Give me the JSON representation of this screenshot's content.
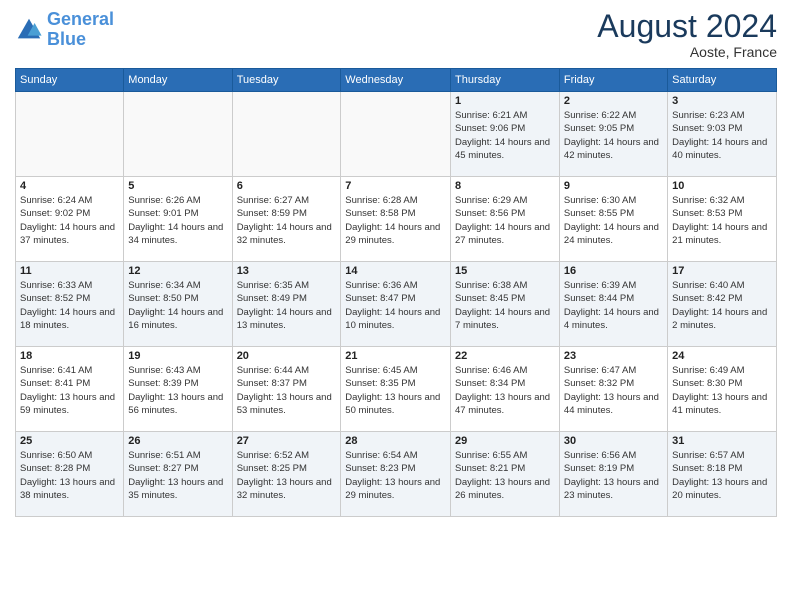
{
  "logo": {
    "line1": "General",
    "line2": "Blue"
  },
  "title": "August 2024",
  "location": "Aoste, France",
  "days_header": [
    "Sunday",
    "Monday",
    "Tuesday",
    "Wednesday",
    "Thursday",
    "Friday",
    "Saturday"
  ],
  "weeks": [
    [
      {
        "num": "",
        "info": ""
      },
      {
        "num": "",
        "info": ""
      },
      {
        "num": "",
        "info": ""
      },
      {
        "num": "",
        "info": ""
      },
      {
        "num": "1",
        "info": "Sunrise: 6:21 AM\nSunset: 9:06 PM\nDaylight: 14 hours and 45 minutes."
      },
      {
        "num": "2",
        "info": "Sunrise: 6:22 AM\nSunset: 9:05 PM\nDaylight: 14 hours and 42 minutes."
      },
      {
        "num": "3",
        "info": "Sunrise: 6:23 AM\nSunset: 9:03 PM\nDaylight: 14 hours and 40 minutes."
      }
    ],
    [
      {
        "num": "4",
        "info": "Sunrise: 6:24 AM\nSunset: 9:02 PM\nDaylight: 14 hours and 37 minutes."
      },
      {
        "num": "5",
        "info": "Sunrise: 6:26 AM\nSunset: 9:01 PM\nDaylight: 14 hours and 34 minutes."
      },
      {
        "num": "6",
        "info": "Sunrise: 6:27 AM\nSunset: 8:59 PM\nDaylight: 14 hours and 32 minutes."
      },
      {
        "num": "7",
        "info": "Sunrise: 6:28 AM\nSunset: 8:58 PM\nDaylight: 14 hours and 29 minutes."
      },
      {
        "num": "8",
        "info": "Sunrise: 6:29 AM\nSunset: 8:56 PM\nDaylight: 14 hours and 27 minutes."
      },
      {
        "num": "9",
        "info": "Sunrise: 6:30 AM\nSunset: 8:55 PM\nDaylight: 14 hours and 24 minutes."
      },
      {
        "num": "10",
        "info": "Sunrise: 6:32 AM\nSunset: 8:53 PM\nDaylight: 14 hours and 21 minutes."
      }
    ],
    [
      {
        "num": "11",
        "info": "Sunrise: 6:33 AM\nSunset: 8:52 PM\nDaylight: 14 hours and 18 minutes."
      },
      {
        "num": "12",
        "info": "Sunrise: 6:34 AM\nSunset: 8:50 PM\nDaylight: 14 hours and 16 minutes."
      },
      {
        "num": "13",
        "info": "Sunrise: 6:35 AM\nSunset: 8:49 PM\nDaylight: 14 hours and 13 minutes."
      },
      {
        "num": "14",
        "info": "Sunrise: 6:36 AM\nSunset: 8:47 PM\nDaylight: 14 hours and 10 minutes."
      },
      {
        "num": "15",
        "info": "Sunrise: 6:38 AM\nSunset: 8:45 PM\nDaylight: 14 hours and 7 minutes."
      },
      {
        "num": "16",
        "info": "Sunrise: 6:39 AM\nSunset: 8:44 PM\nDaylight: 14 hours and 4 minutes."
      },
      {
        "num": "17",
        "info": "Sunrise: 6:40 AM\nSunset: 8:42 PM\nDaylight: 14 hours and 2 minutes."
      }
    ],
    [
      {
        "num": "18",
        "info": "Sunrise: 6:41 AM\nSunset: 8:41 PM\nDaylight: 13 hours and 59 minutes."
      },
      {
        "num": "19",
        "info": "Sunrise: 6:43 AM\nSunset: 8:39 PM\nDaylight: 13 hours and 56 minutes."
      },
      {
        "num": "20",
        "info": "Sunrise: 6:44 AM\nSunset: 8:37 PM\nDaylight: 13 hours and 53 minutes."
      },
      {
        "num": "21",
        "info": "Sunrise: 6:45 AM\nSunset: 8:35 PM\nDaylight: 13 hours and 50 minutes."
      },
      {
        "num": "22",
        "info": "Sunrise: 6:46 AM\nSunset: 8:34 PM\nDaylight: 13 hours and 47 minutes."
      },
      {
        "num": "23",
        "info": "Sunrise: 6:47 AM\nSunset: 8:32 PM\nDaylight: 13 hours and 44 minutes."
      },
      {
        "num": "24",
        "info": "Sunrise: 6:49 AM\nSunset: 8:30 PM\nDaylight: 13 hours and 41 minutes."
      }
    ],
    [
      {
        "num": "25",
        "info": "Sunrise: 6:50 AM\nSunset: 8:28 PM\nDaylight: 13 hours and 38 minutes."
      },
      {
        "num": "26",
        "info": "Sunrise: 6:51 AM\nSunset: 8:27 PM\nDaylight: 13 hours and 35 minutes."
      },
      {
        "num": "27",
        "info": "Sunrise: 6:52 AM\nSunset: 8:25 PM\nDaylight: 13 hours and 32 minutes."
      },
      {
        "num": "28",
        "info": "Sunrise: 6:54 AM\nSunset: 8:23 PM\nDaylight: 13 hours and 29 minutes."
      },
      {
        "num": "29",
        "info": "Sunrise: 6:55 AM\nSunset: 8:21 PM\nDaylight: 13 hours and 26 minutes."
      },
      {
        "num": "30",
        "info": "Sunrise: 6:56 AM\nSunset: 8:19 PM\nDaylight: 13 hours and 23 minutes."
      },
      {
        "num": "31",
        "info": "Sunrise: 6:57 AM\nSunset: 8:18 PM\nDaylight: 13 hours and 20 minutes."
      }
    ]
  ]
}
